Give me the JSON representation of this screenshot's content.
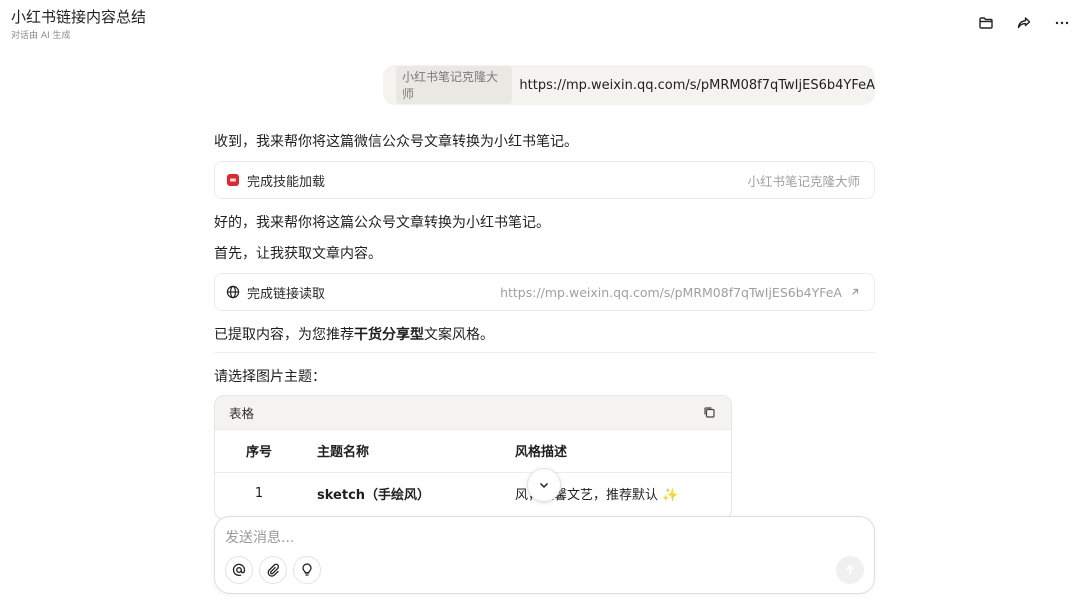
{
  "header": {
    "title": "小红书链接内容总结",
    "subtitle": "对话由 AI 生成",
    "icons": [
      "folder-icon",
      "share-icon",
      "more-icon"
    ]
  },
  "user_message": {
    "skill_tag": "小红书笔记克隆大师",
    "text": "https://mp.weixin.qq.com/s/pMRM08f7qTwIjES6b4YFeA"
  },
  "assistant": {
    "intro": "收到，我来帮你将这篇微信公众号文章转换为小红书笔记。",
    "skill_card": {
      "label": "完成技能加载",
      "right": "小红书笔记克隆大师",
      "icon_color": "#e0262e"
    },
    "line2": "好的，我来帮你将这篇公众号文章转换为小红书笔记。",
    "line3": "首先，让我获取文章内容。",
    "link_card": {
      "label": "完成链接读取",
      "right": "https://mp.weixin.qq.com/s/pMRM08f7qTwIjES6b4YFeA"
    },
    "recommend_prefix": "已提取内容，为您推荐",
    "recommend_bold": "干货分享型",
    "recommend_suffix": "文案风格。",
    "choose_theme": "请选择图片主题：",
    "table": {
      "label": "表格",
      "headers": [
        "序号",
        "主题名称",
        "风格描述"
      ],
      "rows": [
        [
          "1",
          "sketch（手绘风）",
          "温馨文艺，推荐默认 ✨"
        ]
      ],
      "row1_desc_prefix": "风"
    }
  },
  "composer": {
    "placeholder": "发送消息..."
  }
}
